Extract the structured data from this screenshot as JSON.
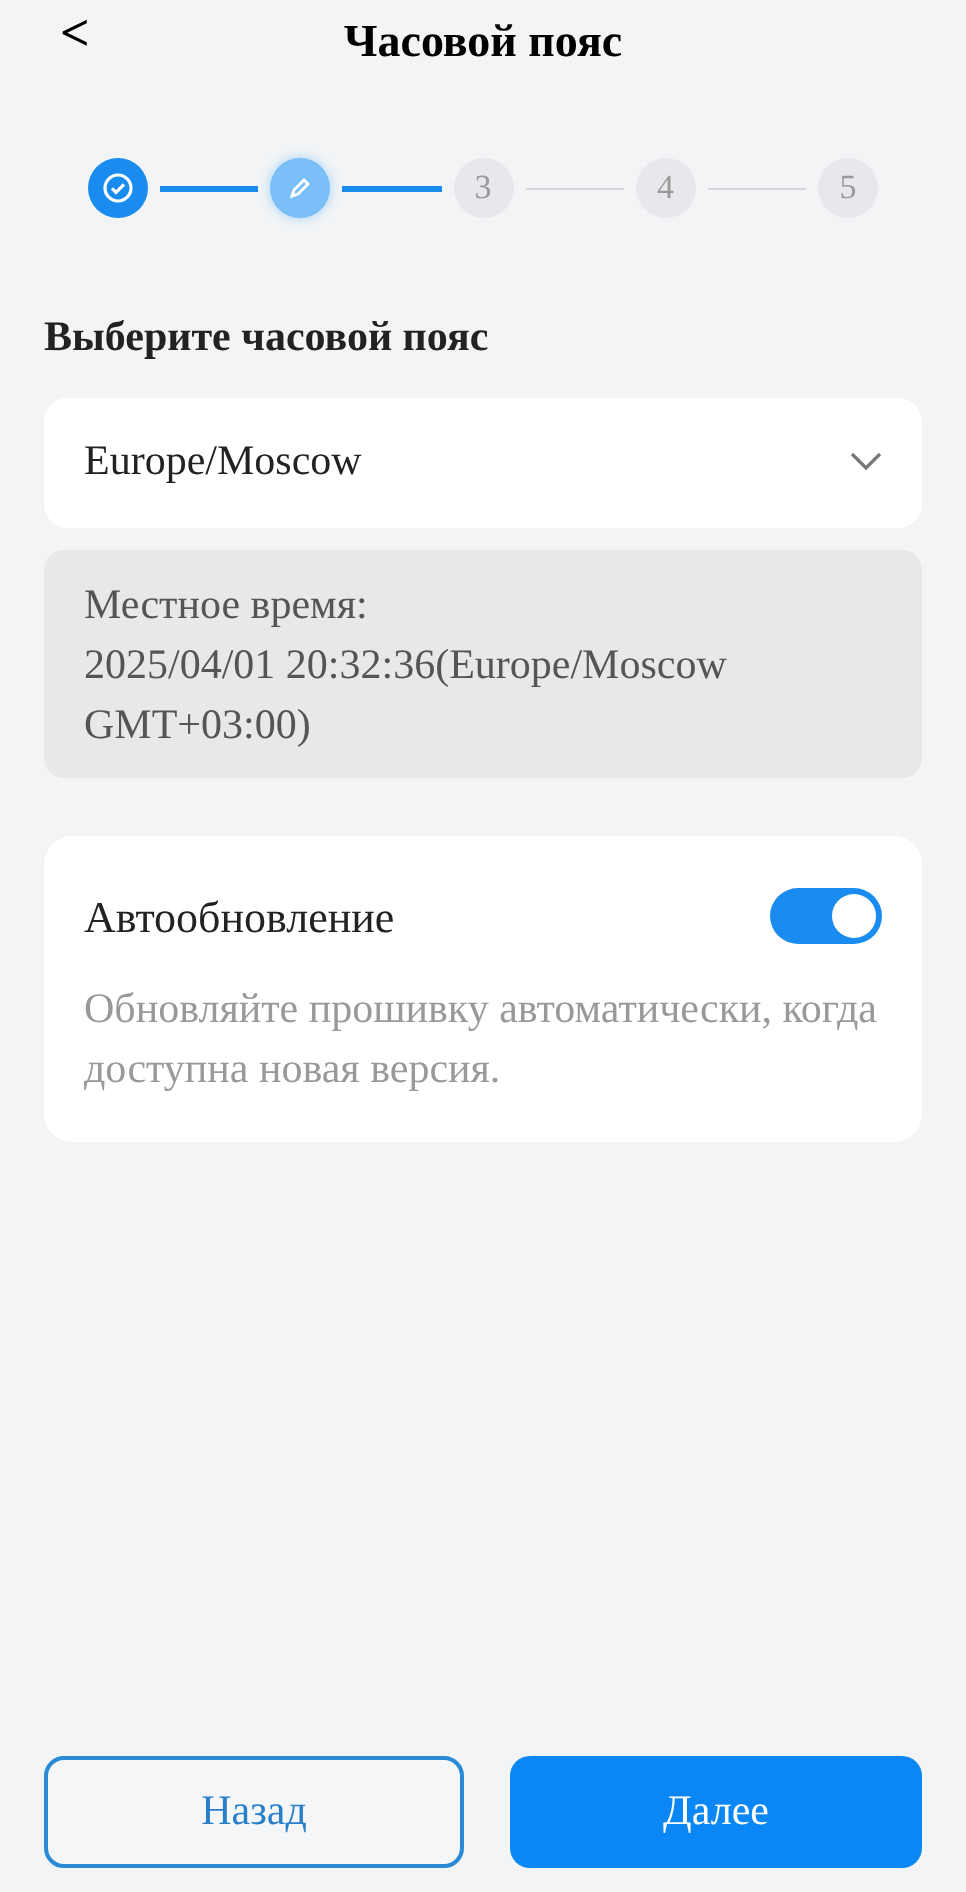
{
  "header": {
    "back": "<",
    "title": "Часовой пояс"
  },
  "steps": [
    {
      "kind": "done"
    },
    {
      "kind": "current"
    },
    {
      "kind": "pending",
      "label": "3"
    },
    {
      "kind": "pending",
      "label": "4"
    },
    {
      "kind": "pending",
      "label": "5"
    }
  ],
  "section_title": "Выберите часовой пояс",
  "timezone_select": {
    "value": "Europe/Moscow"
  },
  "local_time": {
    "label": "Местное время:",
    "value": "2025/04/01 20:32:36(Europe/Moscow GMT+03:00)"
  },
  "auto_update": {
    "label": "Автообновление",
    "on": true,
    "description": "Обновляйте прошивку автоматически, когда доступна новая версия."
  },
  "buttons": [
    {
      "label": "Назад",
      "kind": "secondary"
    },
    {
      "label": "Далее",
      "kind": "primary"
    }
  ]
}
